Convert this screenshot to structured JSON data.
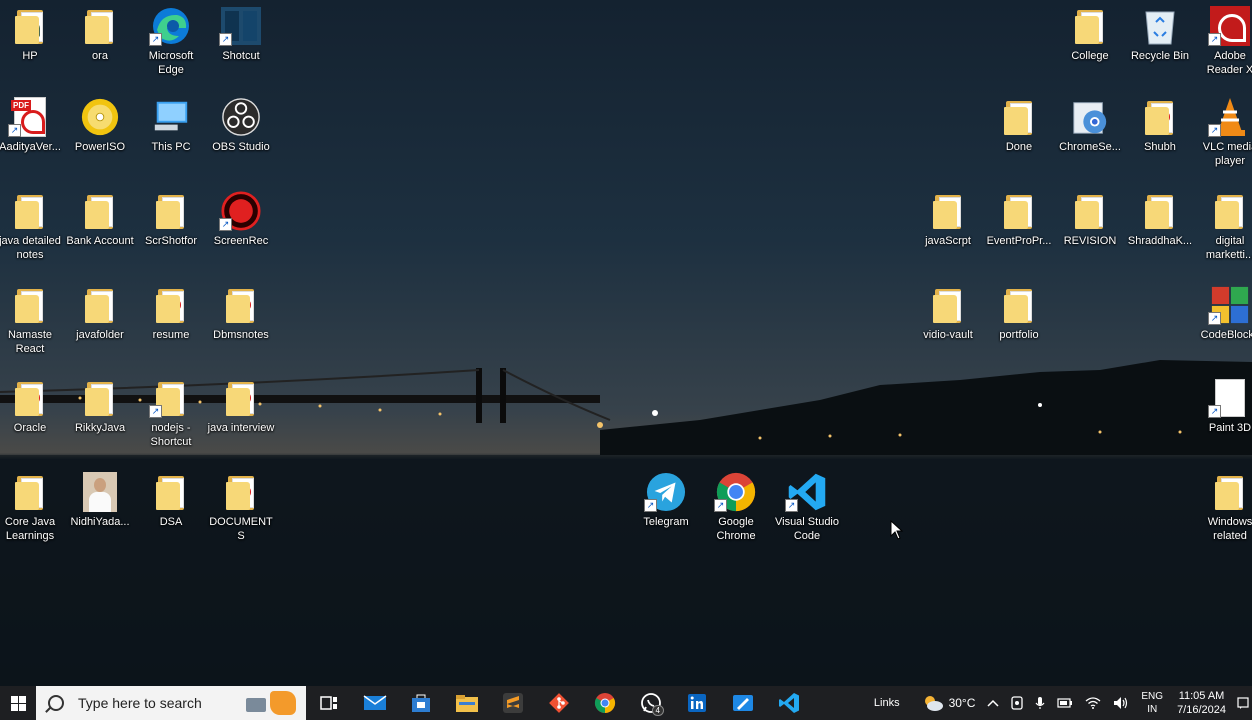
{
  "desktop": {
    "left_icons": [
      {
        "label": "HP",
        "kind": "folder-user"
      },
      {
        "label": "ora",
        "kind": "folder"
      },
      {
        "label": "Microsoft Edge",
        "kind": "edge"
      },
      {
        "label": "Shotcut",
        "kind": "shotcut"
      },
      {
        "label": "AadityaVer...",
        "kind": "pdf"
      },
      {
        "label": "PowerISO",
        "kind": "poweriso"
      },
      {
        "label": "This PC",
        "kind": "thispc"
      },
      {
        "label": "OBS Studio",
        "kind": "obs"
      },
      {
        "label": "java detailed notes",
        "kind": "folder"
      },
      {
        "label": "Bank Account",
        "kind": "folder"
      },
      {
        "label": "ScrShotfor",
        "kind": "folder"
      },
      {
        "label": "ScreenRec",
        "kind": "screenrec"
      },
      {
        "label": "Namaste React",
        "kind": "folder"
      },
      {
        "label": "javafolder",
        "kind": "folder"
      },
      {
        "label": "resume",
        "kind": "folder-pdf"
      },
      {
        "label": "Dbmsnotes",
        "kind": "folder-pdf"
      },
      {
        "label": "Oracle",
        "kind": "folder-pdf"
      },
      {
        "label": "RikkyJava",
        "kind": "folder"
      },
      {
        "label": "nodejs - Shortcut",
        "kind": "folder"
      },
      {
        "label": "java interview",
        "kind": "folder-pdf"
      },
      {
        "label": "Core Java Learnings",
        "kind": "folder"
      },
      {
        "label": "NidhiYada...",
        "kind": "photo"
      },
      {
        "label": "DSA",
        "kind": "folder"
      },
      {
        "label": "DOCUMENTS",
        "kind": "folder-pdf"
      }
    ],
    "right_icons": [
      {
        "label": "College",
        "kind": "folder"
      },
      {
        "label": "Recycle Bin",
        "kind": "recycle"
      },
      {
        "label": "Adobe Reader X",
        "kind": "adobe"
      },
      {
        "label": "Done",
        "kind": "folder"
      },
      {
        "label": "ChromeSe...",
        "kind": "chromesetup"
      },
      {
        "label": "Shubh",
        "kind": "folder-pdf"
      },
      {
        "label": "VLC media player",
        "kind": "vlc"
      },
      {
        "label": "javaScrpt",
        "kind": "folder"
      },
      {
        "label": "EventProPr...",
        "kind": "folder"
      },
      {
        "label": "REVISION",
        "kind": "folder"
      },
      {
        "label": "ShraddhaK...",
        "kind": "folder"
      },
      {
        "label": "digital marketti...",
        "kind": "folder"
      },
      {
        "label": "vidio-vault",
        "kind": "folder"
      },
      {
        "label": "portfolio",
        "kind": "folder"
      },
      {
        "label": "CodeBlocks",
        "kind": "codeblocks"
      },
      {
        "label": "Paint 3D",
        "kind": "doc"
      },
      {
        "label": "Windows related",
        "kind": "folder"
      }
    ],
    "center_icons": [
      {
        "label": "Telegram",
        "kind": "telegram"
      },
      {
        "label": "Google Chrome",
        "kind": "chrome"
      },
      {
        "label": "Visual Studio Code",
        "kind": "vscode"
      }
    ]
  },
  "taskbar": {
    "search_placeholder": "Type here to search",
    "pinned": [
      "task-view-icon",
      "mail-icon",
      "store-icon",
      "file-explorer-icon",
      "sublime-icon",
      "git-icon",
      "chrome-icon",
      "whatsapp-icon",
      "linkedin-icon",
      "paint-icon",
      "vscode-icon"
    ],
    "whatsapp_badge": "4",
    "links_label": "Links",
    "weather": "30°C",
    "language_line1": "ENG",
    "language_line2": "IN",
    "time": "11:05 AM",
    "date": "7/16/2024"
  }
}
